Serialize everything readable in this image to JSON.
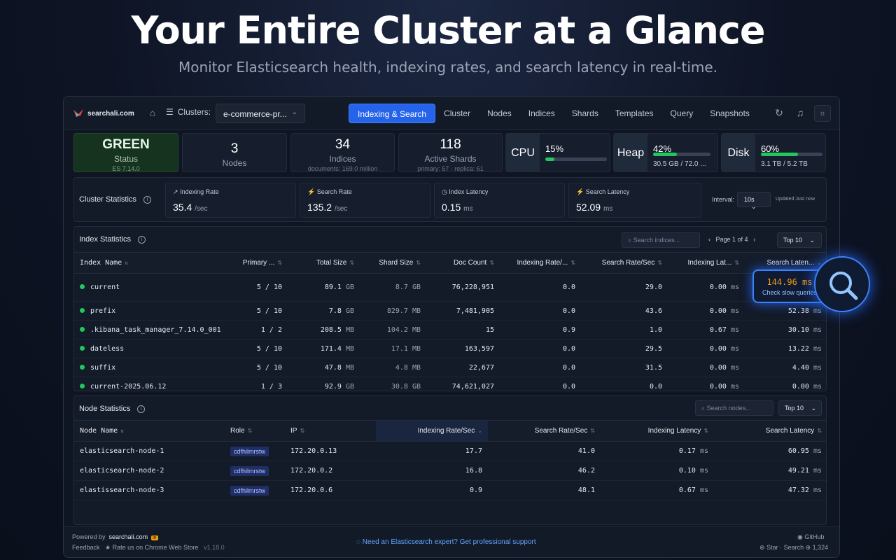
{
  "hero": {
    "title": "Your Entire Cluster at a Glance",
    "subtitle": "Monitor Elasticsearch health, indexing rates, and search latency in real-time."
  },
  "topbar": {
    "brand": "searchali.com",
    "clusters_label": "Clusters:",
    "cluster_selected": "e-commerce-pr...",
    "nav": [
      "Indexing & Search",
      "Cluster",
      "Nodes",
      "Indices",
      "Shards",
      "Templates",
      "Query",
      "Snapshots"
    ],
    "active_nav": "Indexing & Search"
  },
  "cards": {
    "status": {
      "value": "GREEN",
      "label": "Status",
      "sub": "ES 7.14.0"
    },
    "nodes": {
      "value": "3",
      "label": "Nodes"
    },
    "indices": {
      "value": "34",
      "label": "Indices",
      "sub": "documents: 169.0 million"
    },
    "shards": {
      "value": "118",
      "label": "Active Shards",
      "sub": "primary: 57 · replica: 61"
    }
  },
  "resources": {
    "cpu": {
      "name": "CPU",
      "percent": "15%",
      "fraction": 0.15,
      "detail": ""
    },
    "heap": {
      "name": "Heap",
      "percent": "42%",
      "fraction": 0.42,
      "detail": "30.5 GB / 72.0 ..."
    },
    "disk": {
      "name": "Disk",
      "percent": "60%",
      "fraction": 0.6,
      "detail": "3.1 TB / 5.2 TB"
    }
  },
  "cluster_stats": {
    "title": "Cluster Statistics",
    "metrics": [
      {
        "label": "Indexing Rate",
        "value": "35.4",
        "unit": "/sec"
      },
      {
        "label": "Search Rate",
        "value": "135.2",
        "unit": "/sec"
      },
      {
        "label": "Index Latency",
        "value": "0.15",
        "unit": "ms"
      },
      {
        "label": "Search Latency",
        "value": "52.09",
        "unit": "ms"
      }
    ],
    "interval_label": "Interval:",
    "interval_value": "10s",
    "updated": "Updated Just now"
  },
  "index_stats": {
    "title": "Index Statistics",
    "search_placeholder": "Search indices...",
    "pager": "Page 1 of 4",
    "top": "Top 10",
    "columns": [
      "Index Name",
      "Primary ...",
      "Total Size",
      "Shard Size",
      "Doc Count",
      "Indexing Rate/...",
      "Search Rate/Sec",
      "Indexing Lat...",
      "Search Laten..."
    ],
    "rows": [
      {
        "name": "current",
        "shards": "5 / 10",
        "total": "89.1",
        "total_u": "GB",
        "shard": "8.7",
        "shard_u": "GB",
        "docs": "76,228,951",
        "irate": "0.0",
        "srate": "29.0",
        "ilat": "0.00",
        "slat": ""
      },
      {
        "name": "prefix",
        "shards": "5 / 10",
        "total": "7.8",
        "total_u": "GB",
        "shard": "829.7",
        "shard_u": "MB",
        "docs": "7,481,905",
        "irate": "0.0",
        "srate": "43.6",
        "ilat": "0.00",
        "slat": "52.38"
      },
      {
        "name": ".kibana_task_manager_7.14.0_001",
        "shards": "1 / 2",
        "total": "208.5",
        "total_u": "MB",
        "shard": "104.2",
        "shard_u": "MB",
        "docs": "15",
        "irate": "0.9",
        "srate": "1.0",
        "ilat": "0.67",
        "slat": "30.10"
      },
      {
        "name": "dateless",
        "shards": "5 / 10",
        "total": "171.4",
        "total_u": "MB",
        "shard": "17.1",
        "shard_u": "MB",
        "docs": "163,597",
        "irate": "0.0",
        "srate": "29.5",
        "ilat": "0.00",
        "slat": "13.22"
      },
      {
        "name": "suffix",
        "shards": "5 / 10",
        "total": "47.8",
        "total_u": "MB",
        "shard": "4.8",
        "shard_u": "MB",
        "docs": "22,677",
        "irate": "0.0",
        "srate": "31.5",
        "ilat": "0.00",
        "slat": "4.40"
      },
      {
        "name": "current-2025.06.12",
        "shards": "1 / 3",
        "total": "92.9",
        "total_u": "GB",
        "shard": "30.8",
        "shard_u": "GB",
        "docs": "74,621,027",
        "irate": "0.0",
        "srate": "0.0",
        "ilat": "0.00",
        "slat": "0.00"
      }
    ],
    "unit_ms": "ms"
  },
  "slow_callout": {
    "value": "144.96 ms",
    "text": "Check slow queries"
  },
  "node_stats": {
    "title": "Node Statistics",
    "search_placeholder": "Search nodes...",
    "top": "Top 10",
    "columns": [
      "Node Name",
      "Role",
      "IP",
      "Indexing Rate/Sec",
      "Search Rate/Sec",
      "Indexing Latency",
      "Search Latency"
    ],
    "rows": [
      {
        "name": "elasticsearch-node-1",
        "role": "cdfhilmrstw",
        "ip": "172.20.0.13",
        "irate": "17.7",
        "srate": "41.0",
        "ilat": "0.17",
        "slat": "60.95"
      },
      {
        "name": "elasticsearch-node-2",
        "role": "cdfhilmrstw",
        "ip": "172.20.0.2",
        "irate": "16.8",
        "srate": "46.2",
        "ilat": "0.10",
        "slat": "49.21"
      },
      {
        "name": "elastissearch-node-3",
        "role": "cdfhilmrstw",
        "ip": "172.20.0.6",
        "irate": "0.9",
        "srate": "48.1",
        "ilat": "0.67",
        "slat": "47.32"
      }
    ]
  },
  "footer": {
    "powered_by": "Powered by",
    "brand": "searchali.com",
    "feedback": "Feedback",
    "rate": "Rate us on Chrome Web Store",
    "version": "v1.18.0",
    "support": "Need an Elasticsearch expert? Get professional support",
    "github": "GitHub",
    "stars": "Star · Search ⊕ 1,324"
  },
  "colors": {
    "accent": "#2563eb",
    "green": "#22c55e",
    "warning": "#f59e0b"
  }
}
